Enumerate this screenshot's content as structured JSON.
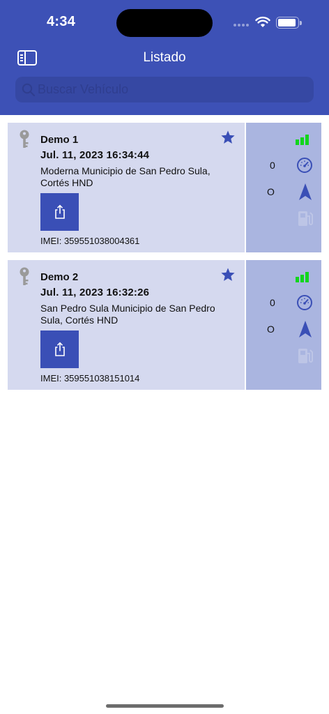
{
  "status_bar": {
    "time": "4:34"
  },
  "nav": {
    "title": "Listado",
    "sidebar_button": "sidebar-icon"
  },
  "search": {
    "placeholder": "Buscar Vehículo",
    "value": ""
  },
  "colors": {
    "header_bg": "#3d51b6",
    "card_bg": "#d5d9ef",
    "card_side_bg": "#aab5e0",
    "accent": "#3a4fb6",
    "signal_green": "#12d51d"
  },
  "vehicles": [
    {
      "name": "Demo 1",
      "date": "Jul. 11, 2023 16:34:44",
      "address": "Moderna Municipio de San Pedro Sula, Cortés HND",
      "imei": "IMEI: 359551038004361",
      "speed": "0",
      "heading": "O",
      "favorite": true,
      "signal_bars": 3
    },
    {
      "name": "Demo 2",
      "date": "Jul. 11, 2023 16:32:26",
      "address": "San Pedro Sula Municipio de San Pedro Sula, Cortés HND",
      "imei": "IMEI: 359551038151014",
      "speed": "0",
      "heading": "O",
      "favorite": true,
      "signal_bars": 3
    }
  ]
}
